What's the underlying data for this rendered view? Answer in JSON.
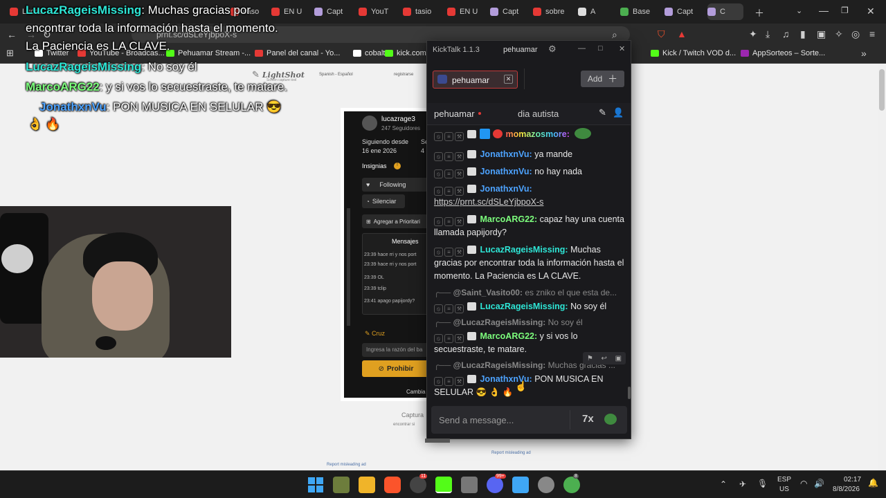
{
  "browser": {
    "tabs": [
      {
        "label": "Lucaz",
        "color": "#e53935"
      },
      {
        "label": "caso",
        "color": "#e53935"
      },
      {
        "label": "EN U",
        "color": "#e53935"
      },
      {
        "label": "Capt",
        "color": "#b39ddb"
      },
      {
        "label": "YouT",
        "color": "#e53935"
      },
      {
        "label": "tasio",
        "color": "#e53935"
      },
      {
        "label": "EN U",
        "color": "#e53935"
      },
      {
        "label": "Capt",
        "color": "#b39ddb"
      },
      {
        "label": "sobre",
        "color": "#e53935"
      },
      {
        "label": "A",
        "color": "#dddddd"
      },
      {
        "label": "Base",
        "color": "#4caf50"
      },
      {
        "label": "Capt",
        "color": "#b39ddb"
      },
      {
        "label": "C",
        "color": "#b39ddb"
      }
    ],
    "address": "prnt.sc/dSLeYjbpoX-s",
    "bookmarks": [
      {
        "label": "Twitter",
        "color": "#ffffff"
      },
      {
        "label": "YouTube - Broadcas...",
        "color": "#e53935"
      },
      {
        "label": "Pehuamar Stream -...",
        "color": "#53fc18"
      },
      {
        "label": "Panel del canal - Yo...",
        "color": "#e53935"
      },
      {
        "label": "cobalt",
        "color": "#ffffff"
      },
      {
        "label": "kick.com/",
        "color": "#53fc18"
      },
      {
        "label": "Kick / Twitch VOD d...",
        "color": "#53fc18"
      },
      {
        "label": "AppSorteos – Sorte...",
        "color": "#9c27b0"
      }
    ]
  },
  "overlay": {
    "lines": [
      {
        "user": "LucazRageisMissing",
        "color": "#2ee6d6",
        "text": ": Muchas gracias por"
      },
      {
        "user": "",
        "color": "",
        "text": "encontrar toda la información hasta el momento."
      },
      {
        "user": "",
        "color": "",
        "text": "La Paciencia es LA CLAVE."
      },
      {
        "user": "LucazRageisMissing",
        "color": "#2ee6d6",
        "text": ": No soy él"
      },
      {
        "user": "MarcoARG22",
        "color": "#7dff7d",
        "text": ": y si vos lo secuestraste, te matare."
      },
      {
        "user": "JonathxnVu",
        "color": "#4da3ff",
        "text": ": PON MUSICA EN SELULAR 😎"
      },
      {
        "user": "",
        "color": "",
        "text": "👌 🔥"
      }
    ]
  },
  "lightshot": {
    "brand": "LightShot",
    "tagline": "Screen capture tool",
    "lang": "Spanish - Español",
    "register": "registrarse"
  },
  "card": {
    "name": "lucazrage3",
    "followers": "247 Seguidores",
    "following_since_label": "Siguiendo desde",
    "following_since": "16 ene 2026",
    "col2": "Se",
    "col2_val": "4",
    "badges": "Insignias",
    "following_btn": "Following",
    "mute_btn": "Silenciar",
    "add_btn": "Agregar a Prioritari",
    "messages_tab": "Mensajes",
    "rows": [
      "23:39 hace rri y nos port",
      "23:39 hace rri y nos port",
      "23:39 OL",
      "23:39 tclip",
      "23:41 apago papijordy?"
    ],
    "ban_label": "Cruz",
    "reason_placeholder": "Ingresa la razón del ba",
    "ban_btn": "Prohibir",
    "change": "Cambia",
    "capture": "Captura",
    "capture_sub": "encontrar si"
  },
  "kicktalk": {
    "title": "KickTalk 1.1.3",
    "user": "pehuamar",
    "channel_chip": "pehuamar",
    "add_btn": "Add",
    "chat_channel": "pehuamar",
    "stream_title": "dia autista",
    "messages": [
      {
        "user": "momazosmore:",
        "color": "rainbow",
        "text": ""
      },
      {
        "user": "JonathxnVu:",
        "color": "#4da3ff",
        "text": "ya mande"
      },
      {
        "user": "JonathxnVu:",
        "color": "#4da3ff",
        "text": "no hay nada"
      },
      {
        "user": "JonathxnVu:",
        "color": "#4da3ff",
        "text": "https://prnt.sc/dSLeYjbpoX-s"
      },
      {
        "user": "MarcoARG22:",
        "color": "#7dff7d",
        "text": "capaz hay una cuenta llamada papijordy?"
      },
      {
        "user": "LucazRageisMissing:",
        "color": "#2ee6d6",
        "text": "Muchas gracias por encontrar toda la información hasta el momento. La Paciencia es LA CLAVE."
      },
      {
        "user": "LucazRageisMissing:",
        "color": "#2ee6d6",
        "text": "No soy él"
      },
      {
        "user": "MarcoARG22:",
        "color": "#7dff7d",
        "text": "y si vos lo secuestraste, te matare."
      },
      {
        "user": "JonathxnVu:",
        "color": "#4da3ff",
        "text": "PON MUSICA EN SELULAR 😎 👌 🔥"
      }
    ],
    "replies": [
      {
        "user": "@Saint_Vasito00:",
        "text": "es zniko el que esta de..."
      },
      {
        "user": "@LucazRageisMissing:",
        "text": "No soy él"
      },
      {
        "user": "@LucazRageisMissing:",
        "text": "Muchas gracias ..."
      }
    ],
    "input_placeholder": "Send a message..."
  },
  "ads": {
    "left": "Report misleading ad",
    "right": "Report misleading ad"
  },
  "taskbar": {
    "lang1": "ESP",
    "lang2": "US",
    "time": "02:17",
    "date": "8/8/2026",
    "badge1": "11",
    "badge2": "99+",
    "badge3": "8"
  }
}
